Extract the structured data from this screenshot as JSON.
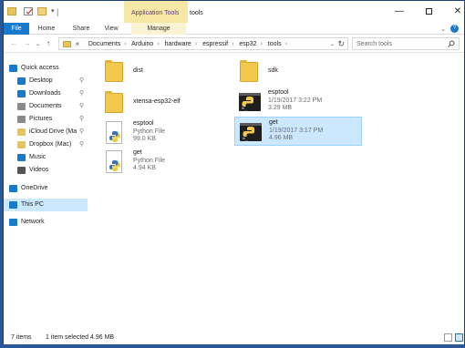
{
  "window": {
    "title": "tools",
    "context_tab_group": "Application Tools"
  },
  "titlebar": {
    "minimize": "—",
    "maximize": "",
    "close": "✕"
  },
  "ribbon": {
    "tabs": [
      "File",
      "Home",
      "Share",
      "View",
      "Manage"
    ],
    "toggle": "⌄",
    "help": "?"
  },
  "navigation": {
    "back": "←",
    "forward": "→",
    "recent": "⌄",
    "up": "↑",
    "breadcrumb_overflow": "«",
    "breadcrumb": [
      "Documents",
      "Arduino",
      "hardware",
      "espressif",
      "esp32",
      "tools"
    ],
    "dropdown": "⌄",
    "refresh": "↻",
    "search_placeholder": "Search tools"
  },
  "sidebar": {
    "items": [
      {
        "label": "Quick access",
        "icon": "star-icon",
        "color": "#1979ca",
        "pinned": false
      },
      {
        "label": "Desktop",
        "icon": "desktop-icon",
        "color": "#1979ca",
        "pinned": true
      },
      {
        "label": "Downloads",
        "icon": "download-icon",
        "color": "#1979ca",
        "pinned": true
      },
      {
        "label": "Documents",
        "icon": "documents-icon",
        "color": "#8a8a8a",
        "pinned": true
      },
      {
        "label": "Pictures",
        "icon": "pictures-icon",
        "color": "#8a8a8a",
        "pinned": true
      },
      {
        "label": "iCloud Drive (Ma",
        "icon": "folder-icon",
        "color": "#e8c35b",
        "pinned": true
      },
      {
        "label": "Dropbox (Mac)",
        "icon": "folder-icon",
        "color": "#e8c35b",
        "pinned": true
      },
      {
        "label": "Music",
        "icon": "music-icon",
        "color": "#1979ca",
        "pinned": false
      },
      {
        "label": "Videos",
        "icon": "videos-icon",
        "color": "#555555",
        "pinned": false
      },
      {
        "label": "OneDrive",
        "icon": "cloud-icon",
        "color": "#1979ca",
        "pinned": false
      },
      {
        "label": "This PC",
        "icon": "computer-icon",
        "color": "#1979ca",
        "pinned": false
      },
      {
        "label": "Network",
        "icon": "network-icon",
        "color": "#1979ca",
        "pinned": false
      }
    ],
    "pin_glyph": "📌"
  },
  "files": [
    {
      "name": "dist",
      "type": "folder",
      "meta1": "",
      "meta2": ""
    },
    {
      "name": "sdk",
      "type": "folder",
      "meta1": "",
      "meta2": ""
    },
    {
      "name": "xtensa-esp32-elf",
      "type": "folder",
      "meta1": "",
      "meta2": ""
    },
    {
      "name": "esptool",
      "type": "exe",
      "meta1": "1/19/2017 3:22 PM",
      "meta2": "3.29 MB"
    },
    {
      "name": "esptool",
      "type": "python",
      "meta1": "Python File",
      "meta2": "99.0 KB"
    },
    {
      "name": "get",
      "type": "exe",
      "meta1": "1/19/2017 3:17 PM",
      "meta2": "4.96 MB",
      "selected": true
    },
    {
      "name": "get",
      "type": "python",
      "meta1": "Python File",
      "meta2": "4.94 KB"
    }
  ],
  "status": {
    "item_count": "7 items",
    "selection": "1 item selected  4.96 MB"
  },
  "colors": {
    "accent": "#1979ca",
    "selection": "#cce8ff",
    "folder": "#f2c94c"
  }
}
